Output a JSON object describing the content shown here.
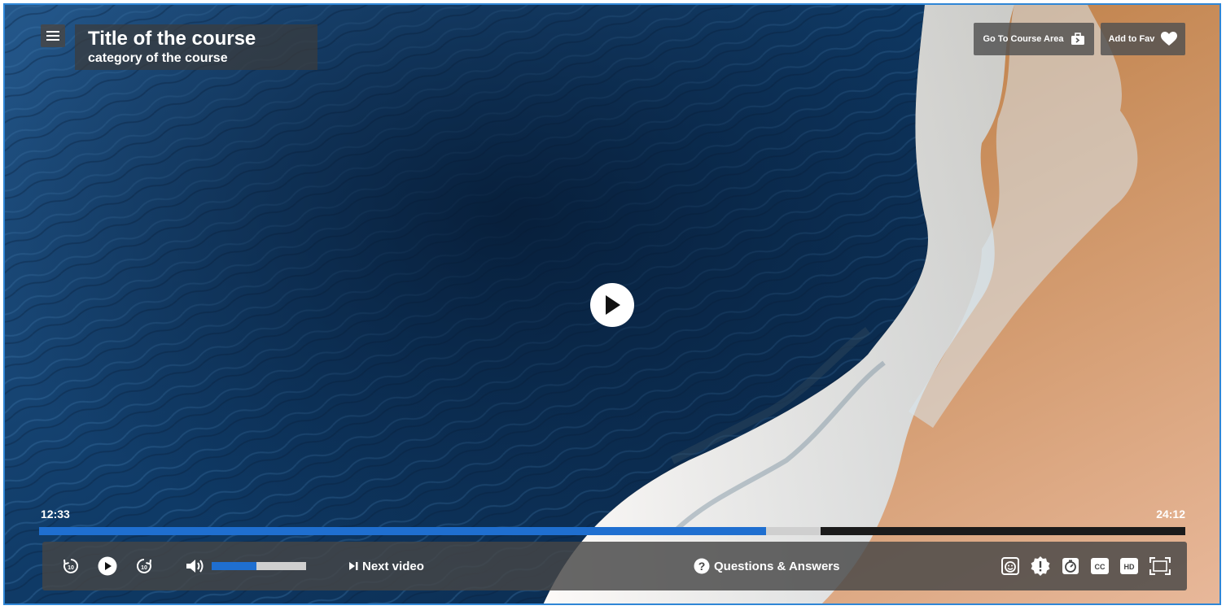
{
  "header": {
    "course_title": "Title of the course",
    "course_category": "category of the course"
  },
  "top_actions": {
    "go_to_course_area": "Go To Course Area",
    "add_to_fav": "Add to Fav"
  },
  "player": {
    "current_time": "12:33",
    "total_time": "24:12",
    "played_fraction": 0.634,
    "buffered_fraction": 0.682,
    "volume_fraction": 0.47
  },
  "controls": {
    "rewind_seconds": "10",
    "forward_seconds": "10",
    "next_video_label": "Next video",
    "qa_label": "Questions & Answers",
    "cc_label": "CC",
    "hd_label": "HD"
  },
  "icons": [
    "menu-icon",
    "briefcase-icon",
    "heart-icon",
    "play-icon",
    "rewind-10-icon",
    "forward-10-icon",
    "volume-icon",
    "skip-next-icon",
    "question-icon",
    "emoji-icon",
    "alert-icon",
    "timer-icon",
    "cc-icon",
    "hd-icon",
    "fullscreen-icon"
  ],
  "colors": {
    "accent": "#1f6fd0",
    "frame_border": "#2f86d6"
  }
}
